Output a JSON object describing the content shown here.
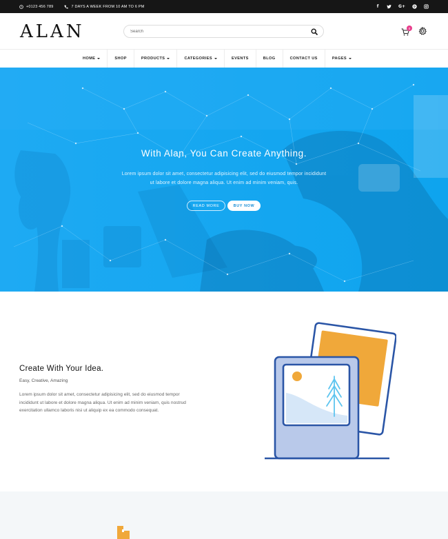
{
  "topbar": {
    "phone": "+0123 456 789",
    "hours": "7 DAYS A WEEK FROM 10 AM TO 6 PM",
    "social": [
      "f",
      "twitter-icon",
      "G+",
      "pinterest-icon",
      "instagram-icon"
    ]
  },
  "header": {
    "logo": "ALAN",
    "search_placeholder": "Search",
    "cart_count": "0"
  },
  "nav": {
    "items": [
      {
        "label": "HOME",
        "dropdown": true
      },
      {
        "label": "SHOP",
        "dropdown": false
      },
      {
        "label": "PRODUCTS",
        "dropdown": true
      },
      {
        "label": "CATEGORIES",
        "dropdown": true
      },
      {
        "label": "EVENTS",
        "dropdown": false
      },
      {
        "label": "BLOG",
        "dropdown": false
      },
      {
        "label": "CONTACT US",
        "dropdown": false
      },
      {
        "label": "PAGES",
        "dropdown": true
      }
    ]
  },
  "hero": {
    "title": "With Alan, You Can Create Anything.",
    "text_line1": "Lorem ipsum dolor sit amet, consectetur adipisicing elit, sed do eiusmod tempor incididunt",
    "text_line2": "ut labore et dolore magna aliqua. Ut enim ad minim veniam, quis.",
    "read_more": "READ MORE",
    "buy_now": "BUY NOW",
    "accent_color": "#10a5ef"
  },
  "feature": {
    "title": "Create With Your Idea.",
    "subtitle": "Easy, Creative, Amazing",
    "text_line1": "Lorem ipsum dolor sit amet, consectetur adipisicing elit, sed do eiusmod tempor",
    "text_line2": "incididunt ut labore et dolore magna aliqua. Ut enim ad minim veniam, quis nostrud",
    "text_line3": "exercitation ullamco laboris nisi ut aliquip ex ea commodo consequat."
  }
}
